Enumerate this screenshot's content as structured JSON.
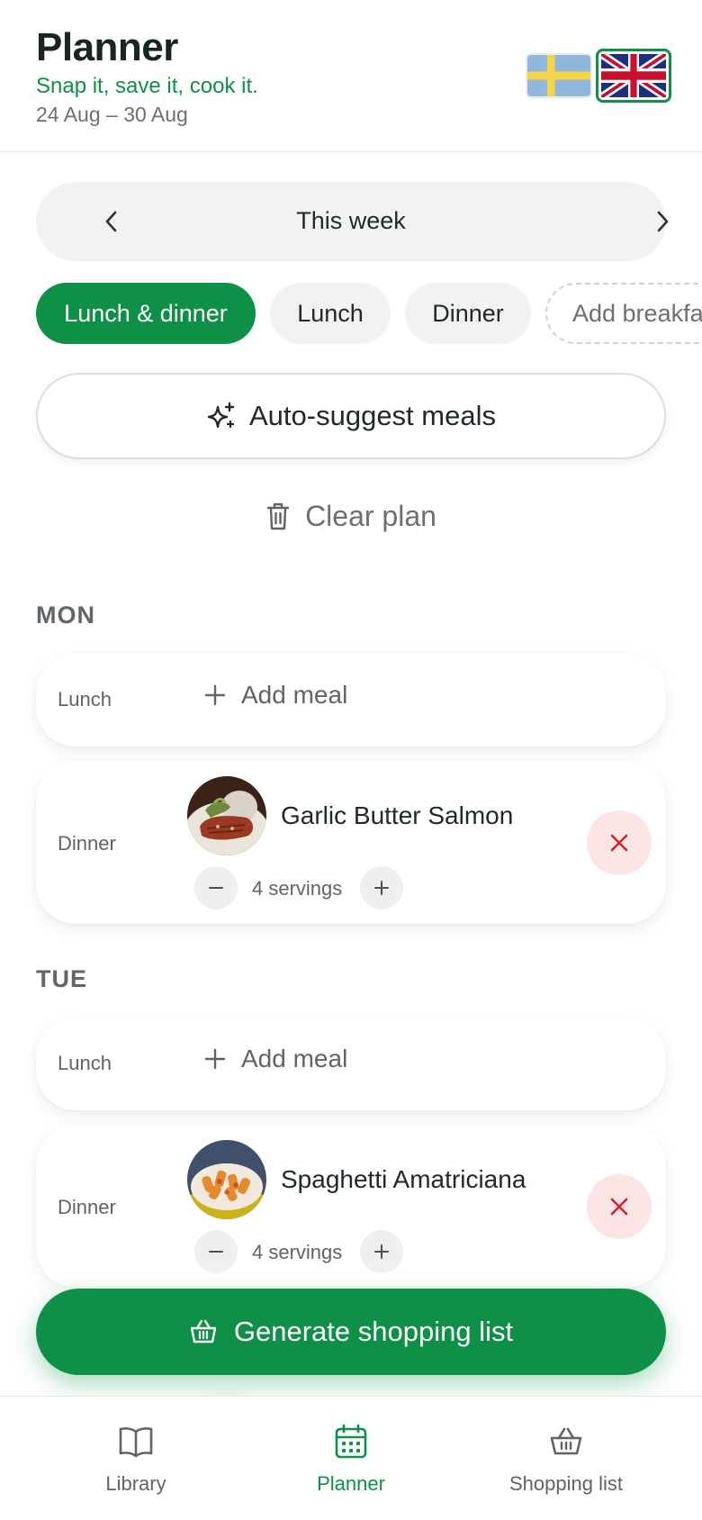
{
  "header": {
    "title": "Planner",
    "tagline": "Snap it, save it, cook it.",
    "date_range": "24 Aug – 30 Aug",
    "languages": [
      {
        "code": "sv",
        "flag": "sweden-flag",
        "selected": false
      },
      {
        "code": "en",
        "flag": "uk-flag",
        "selected": true
      }
    ]
  },
  "week_nav": {
    "label": "This week",
    "prev_icon": "chevron-left-icon",
    "next_icon": "chevron-right-icon"
  },
  "filters": [
    {
      "label": "Lunch & dinner",
      "selected": true
    },
    {
      "label": "Lunch",
      "selected": false
    },
    {
      "label": "Dinner",
      "selected": false
    },
    {
      "label": "Add breakfast",
      "selected": false
    }
  ],
  "actions": {
    "auto_suggest": "Auto-suggest meals",
    "clear_plan": "Clear plan",
    "generate": "Generate shopping list"
  },
  "days": [
    {
      "name": "MON",
      "slots": [
        {
          "label": "Lunch",
          "add_label": "Add meal"
        },
        {
          "label": "Dinner",
          "meal": "Garlic Butter Salmon",
          "servings": "4 servings"
        }
      ]
    },
    {
      "name": "TUE",
      "slots": [
        {
          "label": "Lunch",
          "add_label": "Add meal"
        },
        {
          "label": "Dinner",
          "meal": "Spaghetti Amatriciana",
          "servings": "4 servings"
        }
      ]
    }
  ],
  "tabbar": [
    {
      "label": "Library",
      "icon": "book-icon",
      "active": false
    },
    {
      "label": "Planner",
      "icon": "calendar-icon",
      "active": true
    },
    {
      "label": "Shopping list",
      "icon": "basket-icon",
      "active": false
    }
  ],
  "colors": {
    "brand_green": "#0e9146",
    "remove_bg": "#fde4e5",
    "remove_icon": "#d3222a",
    "chip_bg": "#f1f2f1"
  }
}
